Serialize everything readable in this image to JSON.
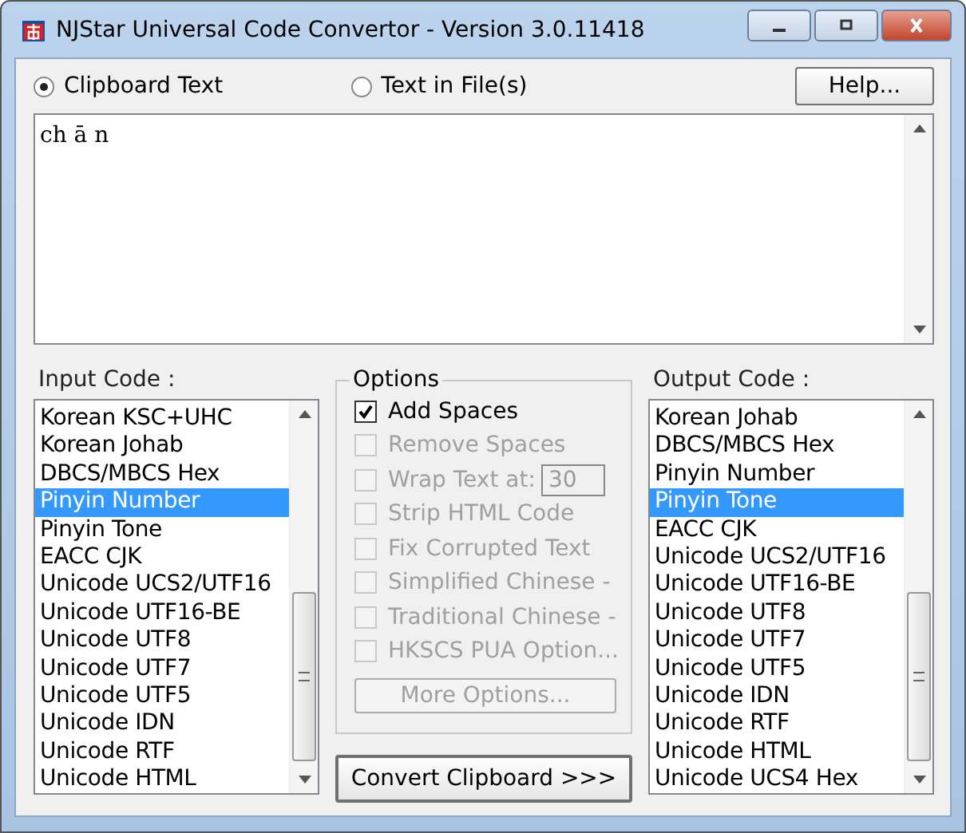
{
  "window": {
    "title": "NJStar Universal Code Convertor - Version 3.0.11418"
  },
  "source": [
    {
      "label": "Clipboard Text",
      "selected": true
    },
    {
      "label": "Text in File(s)",
      "selected": false
    }
  ],
  "help_button": "Help...",
  "text_area": {
    "value": "ch ā n"
  },
  "input_code": {
    "label": "Input Code :",
    "items": [
      {
        "label": "Korean KSC+UHC",
        "selected": false
      },
      {
        "label": "Korean Johab",
        "selected": false
      },
      {
        "label": "DBCS/MBCS Hex",
        "selected": false
      },
      {
        "label": "Pinyin Number",
        "selected": true
      },
      {
        "label": "Pinyin Tone",
        "selected": false
      },
      {
        "label": "EACC CJK",
        "selected": false
      },
      {
        "label": "Unicode UCS2/UTF16",
        "selected": false
      },
      {
        "label": "Unicode UTF16-BE",
        "selected": false
      },
      {
        "label": "Unicode UTF8",
        "selected": false
      },
      {
        "label": "Unicode UTF7",
        "selected": false
      },
      {
        "label": "Unicode UTF5",
        "selected": false
      },
      {
        "label": "Unicode IDN",
        "selected": false
      },
      {
        "label": "Unicode RTF",
        "selected": false
      },
      {
        "label": "Unicode HTML",
        "selected": false
      }
    ]
  },
  "options": {
    "title": "Options",
    "items": [
      {
        "label": "Add Spaces",
        "checked": true,
        "disabled": false
      },
      {
        "label": "Remove Spaces",
        "checked": false,
        "disabled": true
      },
      {
        "label": "Wrap Text at:",
        "checked": false,
        "disabled": true,
        "value": "30"
      },
      {
        "label": "Strip HTML Code",
        "checked": false,
        "disabled": true
      },
      {
        "label": "Fix Corrupted Text",
        "checked": false,
        "disabled": true
      },
      {
        "label": "Simplified Chinese  -",
        "checked": false,
        "disabled": true
      },
      {
        "label": "Traditional Chinese -",
        "checked": false,
        "disabled": true
      },
      {
        "label": "HKSCS PUA Option...",
        "checked": false,
        "disabled": true
      }
    ],
    "more_button": {
      "label": "More Options...",
      "disabled": true
    }
  },
  "convert_button": "Convert Clipboard >>>",
  "output_code": {
    "label": "Output Code :",
    "items": [
      {
        "label": "Korean Johab",
        "selected": false
      },
      {
        "label": "DBCS/MBCS Hex",
        "selected": false
      },
      {
        "label": "Pinyin Number",
        "selected": false
      },
      {
        "label": "Pinyin Tone",
        "selected": true
      },
      {
        "label": "EACC CJK",
        "selected": false
      },
      {
        "label": "Unicode UCS2/UTF16",
        "selected": false
      },
      {
        "label": "Unicode UTF16-BE",
        "selected": false
      },
      {
        "label": "Unicode UTF8",
        "selected": false
      },
      {
        "label": "Unicode UTF7",
        "selected": false
      },
      {
        "label": "Unicode UTF5",
        "selected": false
      },
      {
        "label": "Unicode IDN",
        "selected": false
      },
      {
        "label": "Unicode RTF",
        "selected": false
      },
      {
        "label": "Unicode HTML",
        "selected": false
      },
      {
        "label": "Unicode UCS4 Hex",
        "selected": false
      }
    ]
  }
}
